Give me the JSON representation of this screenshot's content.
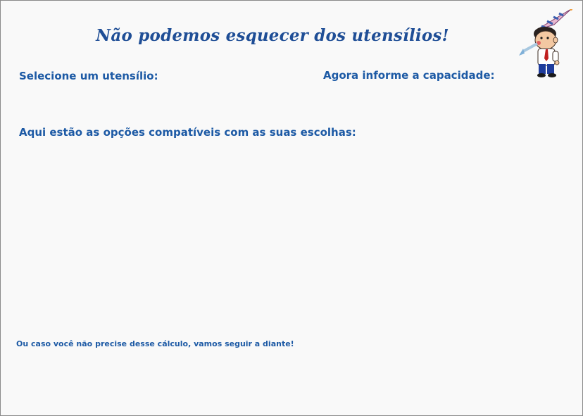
{
  "title": "Não podemos esquecer dos utensílios!",
  "labels": {
    "select_utensil": "Selecione um utensílio:",
    "inform_capacity": "Agora informe a capacidade:",
    "compatible_options": "Aqui estão as opções compatíveis com as suas escolhas:"
  },
  "footer": {
    "skip_link": "Ou caso você não precise desse cálculo, vamos seguir a diante!"
  },
  "colors": {
    "accent": "#1d5aa5",
    "title": "#1f4e96",
    "background": "#f9f9f9"
  },
  "icons": {
    "mascot": "party-boy-mascot-icon"
  }
}
